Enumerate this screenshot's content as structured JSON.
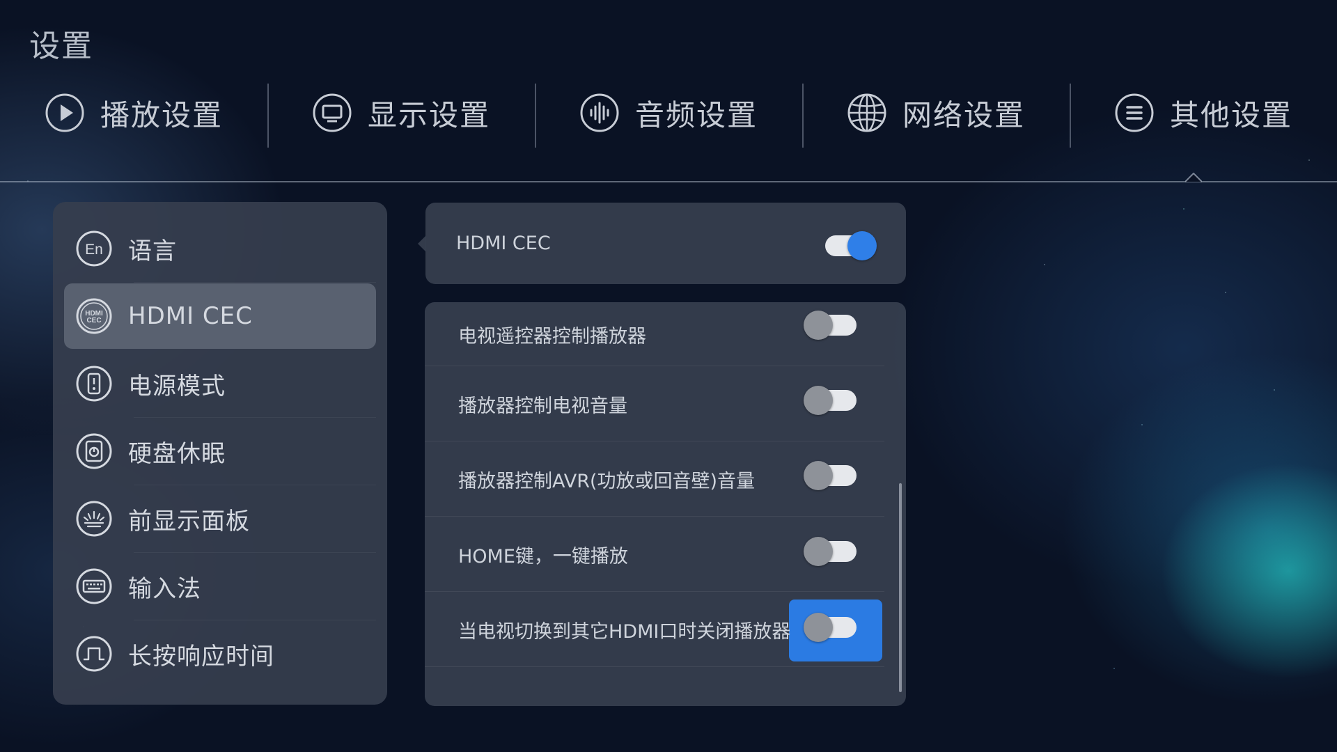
{
  "page": {
    "title": "设置"
  },
  "top_tabs": [
    {
      "label": "播放设置",
      "icon": "play-icon"
    },
    {
      "label": "显示设置",
      "icon": "display-icon"
    },
    {
      "label": "音频设置",
      "icon": "audio-icon"
    },
    {
      "label": "网络设置",
      "icon": "globe-icon"
    },
    {
      "label": "其他设置",
      "icon": "menu-icon",
      "selected": true
    }
  ],
  "sidebar": {
    "items": [
      {
        "label": "语言",
        "icon": "language-icon",
        "icon_text": "En"
      },
      {
        "label": "HDMI CEC",
        "icon": "hdmi-cec-icon",
        "icon_text": "HDMI CEC",
        "active": true
      },
      {
        "label": "电源模式",
        "icon": "power-mode-icon"
      },
      {
        "label": "硬盘休眠",
        "icon": "disk-sleep-icon"
      },
      {
        "label": "前显示面板",
        "icon": "front-panel-icon"
      },
      {
        "label": "输入法",
        "icon": "keyboard-icon"
      },
      {
        "label": "长按响应时间",
        "icon": "long-press-icon"
      }
    ]
  },
  "cec_master": {
    "label": "HDMI CEC",
    "enabled": true
  },
  "options": [
    {
      "label": "电视遥控器控制播放器",
      "enabled": false
    },
    {
      "label": "播放器控制电视音量",
      "enabled": false
    },
    {
      "label": "播放器控制AVR(功放或回音壁)音量",
      "enabled": false
    },
    {
      "label": "HOME键，一键播放",
      "enabled": false
    },
    {
      "label": "当电视切换到其它HDMI口时关闭播放器",
      "enabled": false,
      "focused": true
    }
  ],
  "colors": {
    "background": "#0a1224",
    "panel": "#363e4e",
    "active_item": "#596170",
    "accent": "#2b7be3",
    "toggle_on_knob": "#2f7fe8",
    "toggle_off_knob": "#8e9299"
  }
}
